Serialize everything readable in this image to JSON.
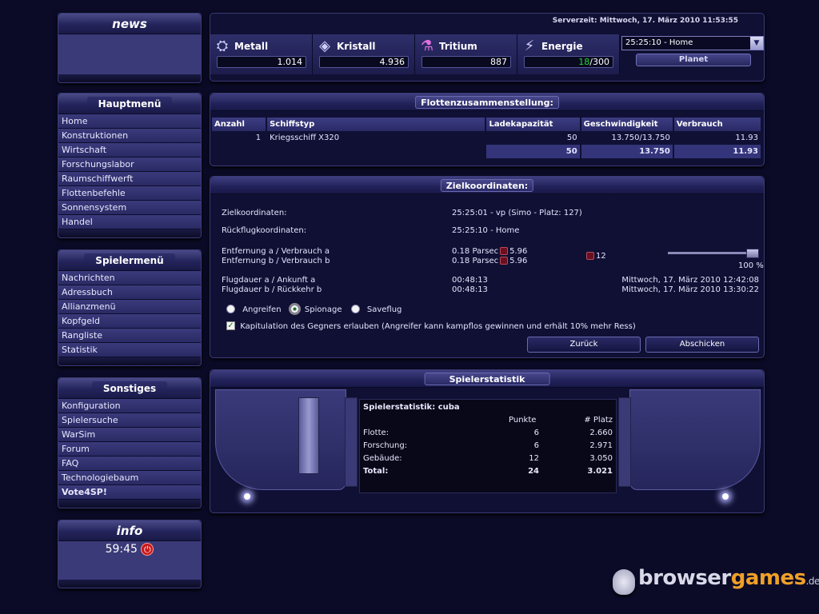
{
  "left": {
    "news_title": "news",
    "hauptmenu": {
      "title": "Hauptmenü",
      "items": [
        "Home",
        "Konstruktionen",
        "Wirtschaft",
        "Forschungslabor",
        "Raumschiffwerft",
        "Flottenbefehle",
        "Sonnensystem",
        "Handel"
      ]
    },
    "spielermenu": {
      "title": "Spielermenü",
      "items": [
        "Nachrichten",
        "Adressbuch",
        "Allianzmenü",
        "Kopfgeld",
        "Rangliste",
        "Statistik"
      ]
    },
    "sonstiges": {
      "title": "Sonstiges",
      "items": [
        "Konfiguration",
        "Spielersuche",
        "WarSim",
        "Forum",
        "FAQ",
        "Technologiebaum",
        "Vote4SP!"
      ]
    },
    "info": {
      "title": "info",
      "timer": "59:45",
      "power_icon": "power-icon"
    }
  },
  "top": {
    "server_time": "Serverzeit: Mittwoch, 17. März 2010 11:53:55",
    "resources": [
      {
        "name": "Metall",
        "value": "1.014",
        "icon": "metal-icon"
      },
      {
        "name": "Kristall",
        "value": "4.936",
        "icon": "crystal-icon"
      },
      {
        "name": "Tritium",
        "value": "887",
        "icon": "tritium-icon"
      },
      {
        "name": "Energie",
        "value_used": "18",
        "value_total": "/300",
        "icon": "energy-icon",
        "used_color": "#28d828"
      }
    ],
    "planet_select": "25:25:10 - Home",
    "planet_button": "Planet"
  },
  "fleet": {
    "title": "Flottenzusammenstellung:",
    "headers": [
      "Anzahl",
      "Schiffstyp",
      "Ladekapazität",
      "Geschwindigkeit",
      "Verbrauch"
    ],
    "row": {
      "anzahl": "1",
      "typ": "Kriegsschiff X320",
      "lade": "50",
      "speed": "13.750/13.750",
      "verbrauch": "11.93"
    },
    "sum": {
      "lade": "50",
      "speed": "13.750",
      "verbrauch": "11.93"
    }
  },
  "ziel": {
    "title": "Zielkoordinaten:",
    "ziel_label": "Zielkoordinaten:",
    "ziel_value": "25:25:01 - vp (Simo - Platz: 127)",
    "rueck_label": "Rückflugkoordinaten:",
    "rueck_value": "25:25:10 - Home",
    "entf_a_label": "Entfernung a / Verbrauch a",
    "entf_b_label": "Entfernung b / Verbrauch b",
    "entf_a_value": "0.18 Parsec",
    "entf_a_verbrauch": "5.96",
    "entf_b_value": "0.18 Parsec",
    "entf_b_verbrauch": "5.96",
    "extra_value": "12",
    "slider_percent": "100 %",
    "flug_a_label": "Flugdauer a / Ankunft a",
    "flug_b_label": "Flugdauer b / Rückkehr b",
    "flug_a_value": "00:48:13",
    "flug_b_value": "00:48:13",
    "ankunft_a": "Mittwoch, 17. März 2010 12:42:08",
    "rueckkehr_b": "Mittwoch, 17. März 2010 13:30:22",
    "mission_options": [
      "Angreifen",
      "Spionage",
      "Saveflug"
    ],
    "selected_mission": "Spionage",
    "kapitulation_text": "Kapitulation des Gegners erlauben (Angreifer kann kampflos gewinnen und erhält 10% mehr Ress)",
    "kapitulation_checked": true,
    "back_button": "Zurück",
    "send_button": "Abschicken"
  },
  "stats": {
    "title": "Spielerstatistik",
    "box_title": "Spielerstatistik: cuba",
    "col_points": "Punkte",
    "col_rank": "# Platz",
    "rows": [
      {
        "label": "Flotte:",
        "points": "6",
        "rank": "2.660"
      },
      {
        "label": "Forschung:",
        "points": "6",
        "rank": "2.971"
      },
      {
        "label": "Gebäude:",
        "points": "12",
        "rank": "3.050"
      },
      {
        "label": "Total:",
        "points": "24",
        "rank": "3.021"
      }
    ]
  },
  "watermark": {
    "part1": "browser",
    "part2": "games",
    "part3": ".de"
  }
}
